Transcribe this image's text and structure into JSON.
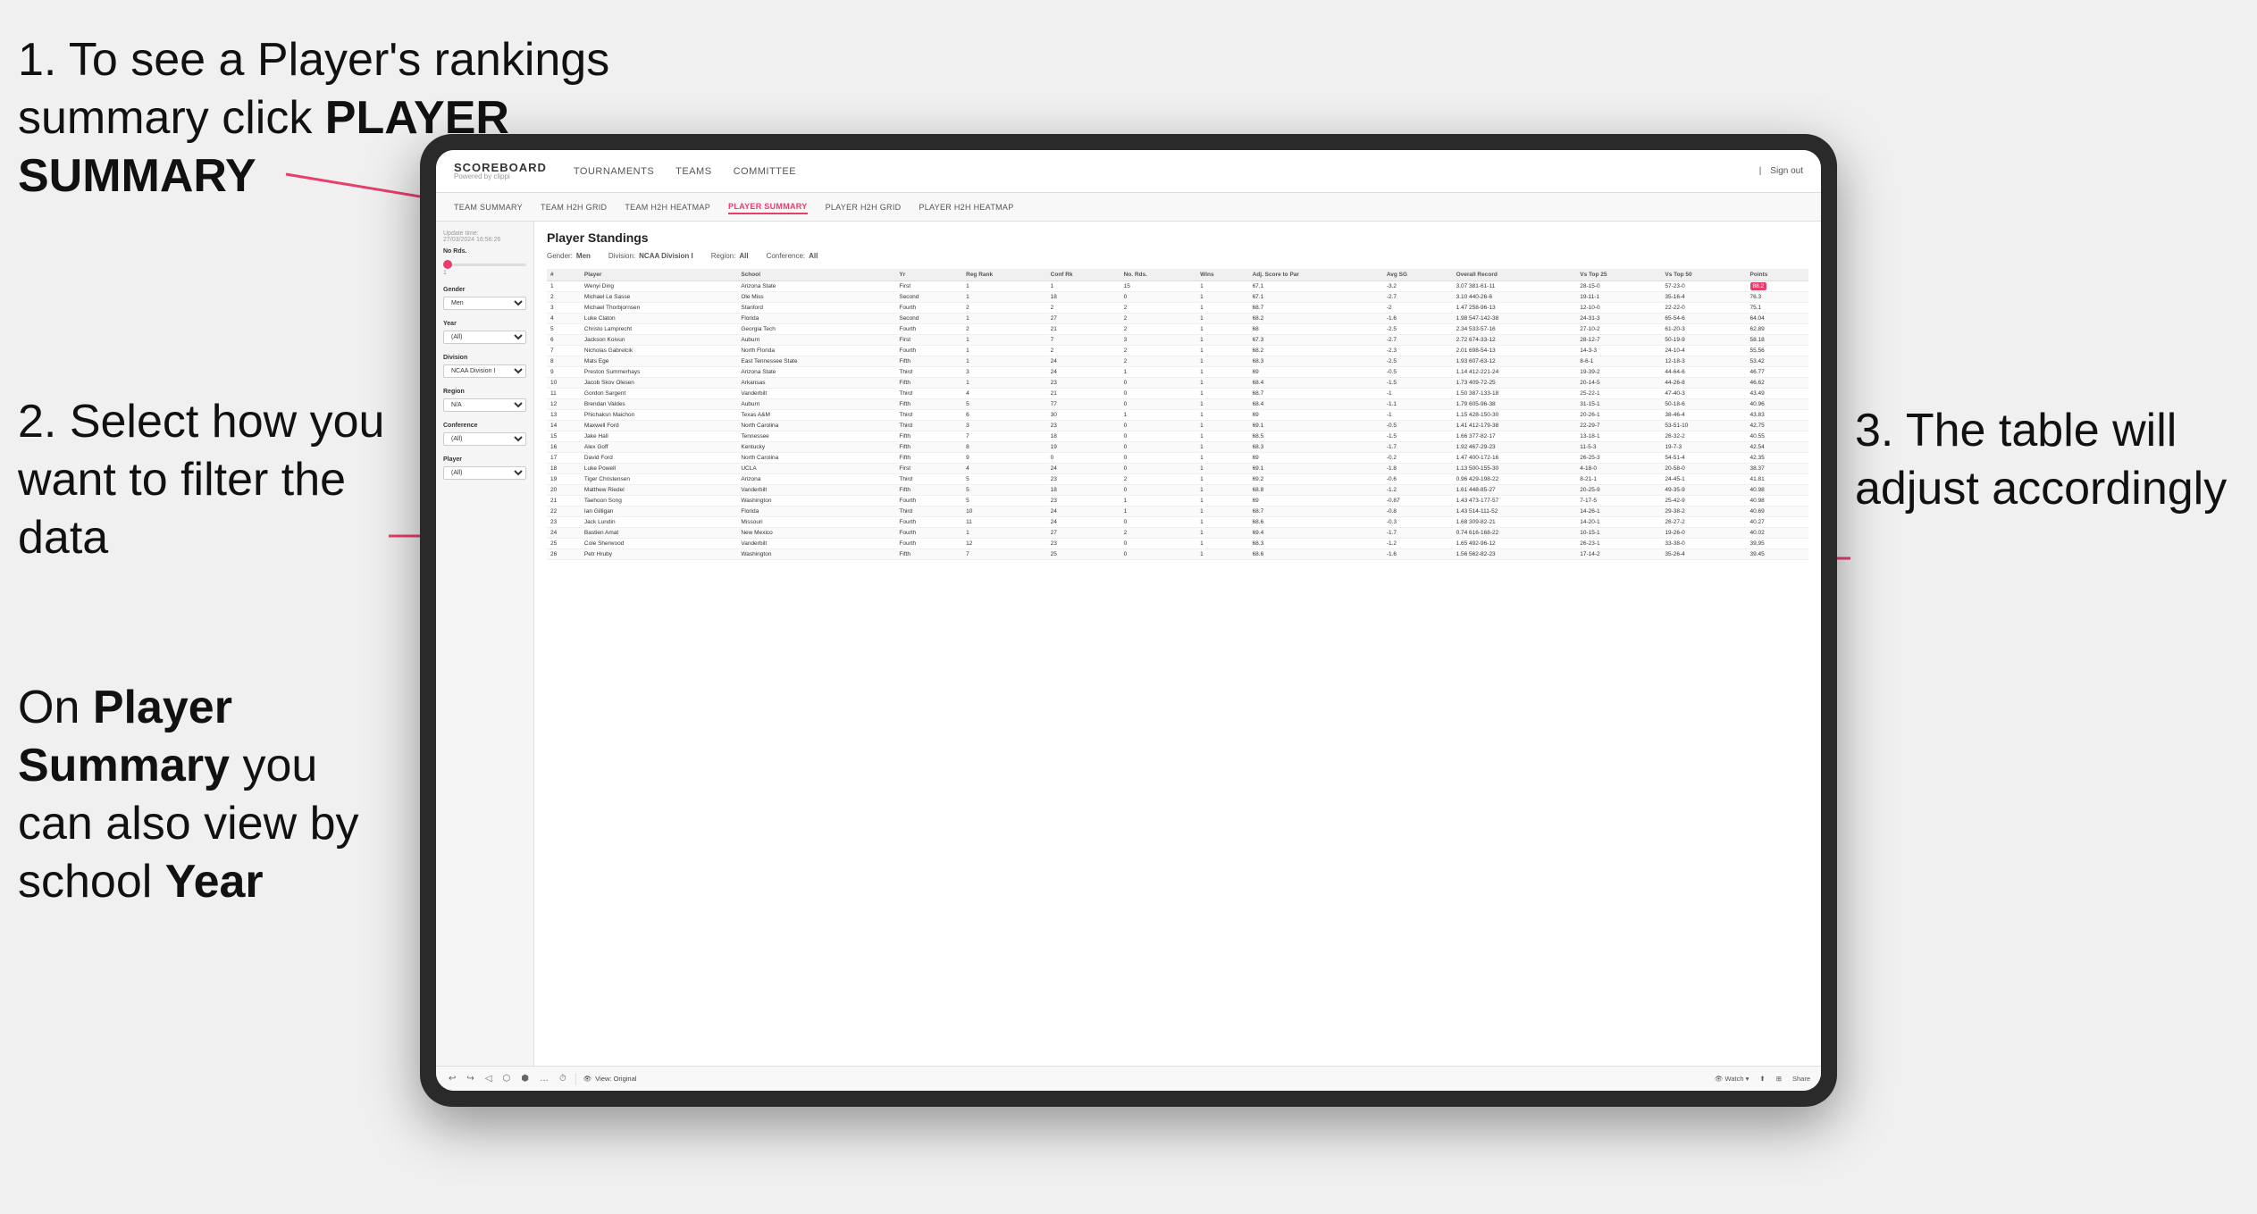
{
  "annotations": {
    "step1": "1. To see a Player's rankings summary click ",
    "step1_bold": "PLAYER SUMMARY",
    "step2_line1": "2. Select how",
    "step2_line2": "you want to",
    "step2_line3": "filter the data",
    "step3_line1": "On ",
    "step3_bold1": "Player",
    "step3_line2": "Summary",
    "step3_line3": " you can also view by school ",
    "step3_bold2": "Year",
    "right_annotation_line1": "3. The table will",
    "right_annotation_line2": "adjust accordingly"
  },
  "navbar": {
    "logo_main": "SCOREBOARD",
    "logo_sub": "Powered by clippi",
    "nav_items": [
      {
        "label": "TOURNAMENTS",
        "active": false
      },
      {
        "label": "TEAMS",
        "active": false
      },
      {
        "label": "COMMITTEE",
        "active": false
      }
    ],
    "nav_right": [
      "| Sign out"
    ]
  },
  "subnav": {
    "items": [
      {
        "label": "TEAM SUMMARY",
        "active": false
      },
      {
        "label": "TEAM H2H GRID",
        "active": false
      },
      {
        "label": "TEAM H2H HEATMAP",
        "active": false
      },
      {
        "label": "PLAYER SUMMARY",
        "active": true
      },
      {
        "label": "PLAYER H2H GRID",
        "active": false
      },
      {
        "label": "PLAYER H2H HEATMAP",
        "active": false
      }
    ]
  },
  "sidebar": {
    "update_time": "Update time: 27/03/2024 16:56:26",
    "sections": [
      {
        "label": "No Rds.",
        "type": "slider",
        "value": "1"
      },
      {
        "label": "Gender",
        "type": "select",
        "value": "Men"
      },
      {
        "label": "Year",
        "type": "select",
        "value": "(All)"
      },
      {
        "label": "Division",
        "type": "select",
        "value": "NCAA Division I"
      },
      {
        "label": "Region",
        "type": "select",
        "value": "N/A"
      },
      {
        "label": "Conference",
        "type": "select",
        "value": "(All)"
      },
      {
        "label": "Player",
        "type": "select",
        "value": "(All)"
      }
    ]
  },
  "table": {
    "title": "Player Standings",
    "filters": [
      {
        "label": "Gender:",
        "value": "Men"
      },
      {
        "label": "Division:",
        "value": "NCAA Division I"
      },
      {
        "label": "Region:",
        "value": "All"
      },
      {
        "label": "Conference:",
        "value": "All"
      }
    ],
    "columns": [
      "#",
      "Player",
      "School",
      "Yr",
      "Reg Rank",
      "Conf Rk",
      "No. Rds.",
      "Wins",
      "Adj. Score to Par",
      "Avg SG",
      "Overall Record",
      "Vs Top 25",
      "Vs Top 50",
      "Points"
    ],
    "rows": [
      [
        1,
        "Wenyi Ding",
        "Arizona State",
        "First",
        1,
        1,
        15,
        1,
        67.1,
        -3.2,
        "3.07 381-61-11",
        "28-15-0",
        "57-23-0",
        "88.2"
      ],
      [
        2,
        "Michael Le Sasse",
        "Ole Miss",
        "Second",
        1,
        18,
        0,
        1,
        67.1,
        -2.7,
        "3.10 440-26-6",
        "19-11-1",
        "35-16-4",
        "76.3"
      ],
      [
        3,
        "Michael Thorbjornsen",
        "Stanford",
        "Fourth",
        2,
        2,
        2,
        1,
        68.7,
        -2.0,
        "1.47 258-96-13",
        "12-10-0",
        "22-22-0",
        "75.1"
      ],
      [
        4,
        "Luke Claton",
        "Florida",
        "Second",
        1,
        27,
        2,
        1,
        68.2,
        -1.6,
        "1.98 547-142-38",
        "24-31-3",
        "65-54-6",
        "64.04"
      ],
      [
        5,
        "Christo Lamprecht",
        "Georgia Tech",
        "Fourth",
        2,
        21,
        2,
        1,
        68.0,
        -2.5,
        "2.34 533-57-16",
        "27-10-2",
        "61-20-3",
        "62.89"
      ],
      [
        6,
        "Jackson Koivun",
        "Auburn",
        "First",
        1,
        7,
        3,
        1,
        67.3,
        -2.7,
        "2.72 674-33-12",
        "28-12-7",
        "50-19-9",
        "58.18"
      ],
      [
        7,
        "Nicholas Gabrelcik",
        "North Florida",
        "Fourth",
        1,
        2,
        2,
        1,
        68.2,
        -2.3,
        "2.01 698-54-13",
        "14-3-3",
        "24-10-4",
        "55.56"
      ],
      [
        8,
        "Mats Ege",
        "East Tennessee State",
        "Fifth",
        1,
        24,
        2,
        1,
        68.3,
        -2.5,
        "1.93 607-63-12",
        "8-6-1",
        "12-18-3",
        "53.42"
      ],
      [
        9,
        "Preston Summerhays",
        "Arizona State",
        "Third",
        3,
        24,
        1,
        1,
        69.0,
        -0.5,
        "1.14 412-221-24",
        "19-39-2",
        "44-64-6",
        "46.77"
      ],
      [
        10,
        "Jacob Skov Olesen",
        "Arkansas",
        "Fifth",
        1,
        23,
        0,
        1,
        68.4,
        -1.5,
        "1.73 409-72-25",
        "20-14-5",
        "44-26-8",
        "46.62"
      ],
      [
        11,
        "Gordon Sargent",
        "Vanderbilt",
        "Third",
        4,
        21,
        0,
        1,
        68.7,
        -1.0,
        "1.50 387-133-18",
        "25-22-1",
        "47-40-3",
        "43.49"
      ],
      [
        12,
        "Brendan Valdes",
        "Auburn",
        "Fifth",
        5,
        77,
        0,
        1,
        68.4,
        -1.1,
        "1.79 605-96-38",
        "31-15-1",
        "50-18-6",
        "40.96"
      ],
      [
        13,
        "Phichaksn Maichon",
        "Texas A&M",
        "Third",
        6,
        30,
        1,
        1,
        69.0,
        -1.0,
        "1.15 428-150-30",
        "20-26-1",
        "38-46-4",
        "43.83"
      ],
      [
        14,
        "Maxwell Ford",
        "North Carolina",
        "Third",
        3,
        23,
        0,
        1,
        69.1,
        -0.5,
        "1.41 412-179-38",
        "22-29-7",
        "53-51-10",
        "42.75"
      ],
      [
        15,
        "Jake Hall",
        "Tennessee",
        "Fifth",
        7,
        18,
        0,
        1,
        68.5,
        -1.5,
        "1.66 377-82-17",
        "13-18-1",
        "26-32-2",
        "40.55"
      ],
      [
        16,
        "Alex Goff",
        "Kentucky",
        "Fifth",
        8,
        19,
        0,
        1,
        68.3,
        -1.7,
        "1.92 467-29-23",
        "11-5-3",
        "19-7-3",
        "42.54"
      ],
      [
        17,
        "David Ford",
        "North Carolina",
        "Fifth",
        9,
        0,
        0,
        1,
        69.0,
        -0.2,
        "1.47 400-172-16",
        "26-25-3",
        "54-51-4",
        "42.35"
      ],
      [
        18,
        "Luke Powell",
        "UCLA",
        "First",
        4,
        24,
        0,
        1,
        69.1,
        -1.8,
        "1.13 500-155-30",
        "4-18-0",
        "20-58-0",
        "38.37"
      ],
      [
        19,
        "Tiger Christensen",
        "Arizona",
        "Third",
        5,
        23,
        2,
        1,
        69.2,
        -0.6,
        "0.96 429-198-22",
        "8-21-1",
        "24-45-1",
        "41.81"
      ],
      [
        20,
        "Matthew Riedel",
        "Vanderbilt",
        "Fifth",
        5,
        18,
        0,
        1,
        68.8,
        -1.2,
        "1.61 448-85-27",
        "20-25-9",
        "49-35-9",
        "40.98"
      ],
      [
        21,
        "Taehoon Song",
        "Washington",
        "Fourth",
        5,
        23,
        1,
        1,
        69.0,
        -0.87,
        "1.43 473-177-57",
        "7-17-5",
        "25-42-9",
        "40.98"
      ],
      [
        22,
        "Ian Gilligan",
        "Florida",
        "Third",
        10,
        24,
        1,
        1,
        68.7,
        -0.8,
        "1.43 514-111-52",
        "14-26-1",
        "29-38-2",
        "40.69"
      ],
      [
        23,
        "Jack Lundin",
        "Missouri",
        "Fourth",
        11,
        24,
        0,
        1,
        68.6,
        -0.3,
        "1.68 309-82-21",
        "14-20-1",
        "26-27-2",
        "40.27"
      ],
      [
        24,
        "Bastien Amat",
        "New Mexico",
        "Fourth",
        1,
        27,
        2,
        1,
        69.4,
        -1.7,
        "0.74 616-168-22",
        "10-15-1",
        "19-26-0",
        "40.02"
      ],
      [
        25,
        "Cole Sherwood",
        "Vanderbilt",
        "Fourth",
        12,
        23,
        0,
        1,
        68.3,
        -1.2,
        "1.65 492-96-12",
        "26-23-1",
        "33-38-0",
        "39.95"
      ],
      [
        26,
        "Petr Hruby",
        "Washington",
        "Fifth",
        7,
        25,
        0,
        1,
        68.6,
        -1.6,
        "1.56 562-82-23",
        "17-14-2",
        "35-26-4",
        "39.45"
      ]
    ]
  },
  "toolbar": {
    "view_label": "View: Original",
    "watch_label": "Watch",
    "share_label": "Share"
  }
}
